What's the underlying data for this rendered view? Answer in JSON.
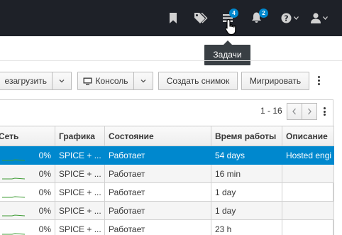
{
  "navbar": {
    "tasks_badge": "4",
    "notifications_badge": "2"
  },
  "tooltip": "Задачи",
  "toolbar": {
    "reboot_label": "езагрузить",
    "console_label": "Консоль",
    "snapshot_label": "Создать снимок",
    "migrate_label": "Мигрировать"
  },
  "pagination": {
    "range": "1 - 16"
  },
  "table": {
    "headers": {
      "network": "Сеть",
      "graphics": "Графика",
      "status": "Состояние",
      "uptime": "Время работы",
      "description": "Описание"
    },
    "rows": [
      {
        "network": "0%",
        "graphics": "SPICE + ...",
        "status": "Работает",
        "uptime": "54 days",
        "description": "Hosted engi"
      },
      {
        "network": "0%",
        "graphics": "SPICE + ...",
        "status": "Работает",
        "uptime": "16 min",
        "description": ""
      },
      {
        "network": "0%",
        "graphics": "SPICE + ...",
        "status": "Работает",
        "uptime": "1 day",
        "description": ""
      },
      {
        "network": "0%",
        "graphics": "SPICE + ...",
        "status": "Работает",
        "uptime": "1 day",
        "description": ""
      },
      {
        "network": "0%",
        "graphics": "SPICE + ...",
        "status": "Работает",
        "uptime": "23 h",
        "description": ""
      }
    ]
  },
  "colors": {
    "navbar_bg": "#1e2128",
    "selected_row": "#0088ce",
    "badge": "#0088ce",
    "sparkline": "#3f9c35"
  }
}
